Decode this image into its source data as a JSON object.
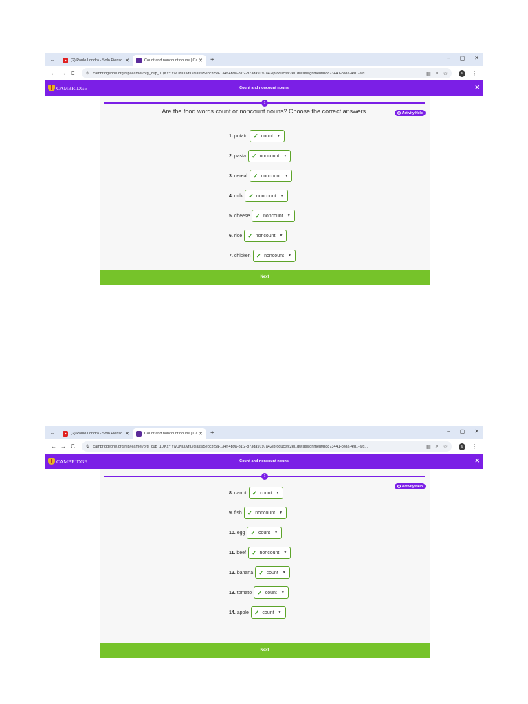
{
  "browser": {
    "tab_list_icon": "chevron-down-icon",
    "tabs": [
      {
        "title": "(2) Paulo Londra - Solo Pienso",
        "close": "✕",
        "favicon": "youtube-icon",
        "favicon_color": "#e02020"
      },
      {
        "title": "Count and noncount nouns | Ca",
        "close": "✕",
        "favicon": "cambridge-icon",
        "favicon_color": "#5b2a9a"
      }
    ],
    "new_tab": "+",
    "window_controls": [
      "–",
      "▢",
      "✕"
    ],
    "url": "cambridgeone.org/nlp/learner/org_cup_10jKxYYwUNuuvrIL/class/5ebc3f5a-134f-4b9a-81f2-873da9197a42/product/fc2el1dw/assignment/b8873441-ce8a-4fd1-afd...",
    "profile_initial": "6"
  },
  "app": {
    "brand": "CAMBRIDGE",
    "title": "Count and noncount nouns",
    "close": "✕",
    "accent_color": "#7b1fe6",
    "success_color": "#76c32a"
  },
  "activity": {
    "progress_step": "1",
    "question": "Are the food words count or noncount nouns? Choose the correct answers.",
    "help_label": "Activity Help",
    "next_label": "Next",
    "page1_items": [
      {
        "num": "1.",
        "word": "potato",
        "answer": "count"
      },
      {
        "num": "2.",
        "word": "pasta",
        "answer": "noncount"
      },
      {
        "num": "3.",
        "word": "cereal",
        "answer": "noncount"
      },
      {
        "num": "4.",
        "word": "milk",
        "answer": "noncount"
      },
      {
        "num": "5.",
        "word": "cheese",
        "answer": "noncount"
      },
      {
        "num": "6.",
        "word": "rice",
        "answer": "noncount"
      },
      {
        "num": "7.",
        "word": "chicken",
        "answer": "noncount"
      }
    ],
    "page2_items": [
      {
        "num": "8.",
        "word": "carrot",
        "answer": "count"
      },
      {
        "num": "9.",
        "word": "fish",
        "answer": "noncount"
      },
      {
        "num": "10.",
        "word": "egg",
        "answer": "count"
      },
      {
        "num": "11.",
        "word": "beef",
        "answer": "noncount"
      },
      {
        "num": "12.",
        "word": "banana",
        "answer": "count"
      },
      {
        "num": "13.",
        "word": "tomato",
        "answer": "count"
      },
      {
        "num": "14.",
        "word": "apple",
        "answer": "count"
      }
    ]
  }
}
